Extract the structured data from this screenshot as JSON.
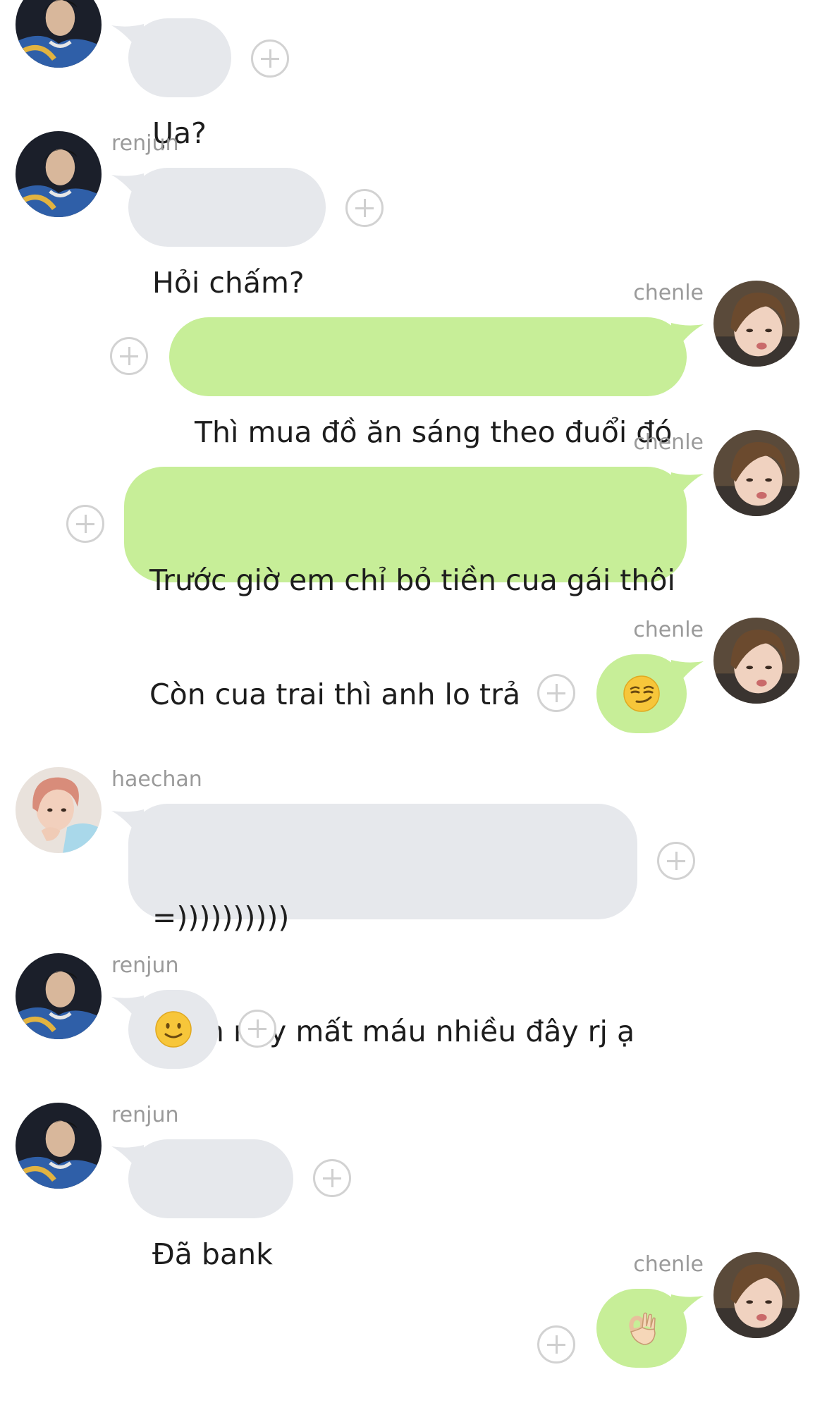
{
  "conversation": {
    "messages": [
      {
        "sender": "renjun",
        "text": "Ụa?",
        "direction": "in",
        "avatar": "renjun-avatar"
      },
      {
        "sender": "renjun",
        "text": "Hỏi chấm?",
        "direction": "in",
        "avatar": "renjun-avatar"
      },
      {
        "sender": "chenle",
        "text": "Thì mua đồ ăn sáng theo đuổi đó",
        "direction": "out",
        "avatar": "chenle-avatar"
      },
      {
        "sender": "chenle",
        "line1": "Trước giờ em chỉ bỏ tiền cua gái thôi",
        "line2": "Còn cua trai thì anh lo trả",
        "direction": "out",
        "avatar": "chenle-avatar"
      },
      {
        "sender": "chenle",
        "emoji": "smirking-face",
        "direction": "out",
        "avatar": "chenle-avatar"
      },
      {
        "sender": "haechan",
        "line1": "=))))))))))",
        "line2": "Phen này mất máu nhiều đây rj ạ",
        "direction": "in",
        "avatar": "haechan-avatar"
      },
      {
        "sender": "renjun",
        "emoji": "slightly-smiling-face",
        "direction": "in",
        "avatar": "renjun-avatar"
      },
      {
        "sender": "renjun",
        "text": "Đã bank",
        "direction": "in",
        "avatar": "renjun-avatar"
      },
      {
        "sender": "chenle",
        "emoji": "ok-hand",
        "direction": "out",
        "avatar": "chenle-avatar"
      }
    ]
  },
  "colors": {
    "incoming_bubble": "#e6e8ec",
    "outgoing_bubble": "#c7ee98",
    "sender_name": "#9a9a9a",
    "reaction_button": "#d2d2d2"
  }
}
